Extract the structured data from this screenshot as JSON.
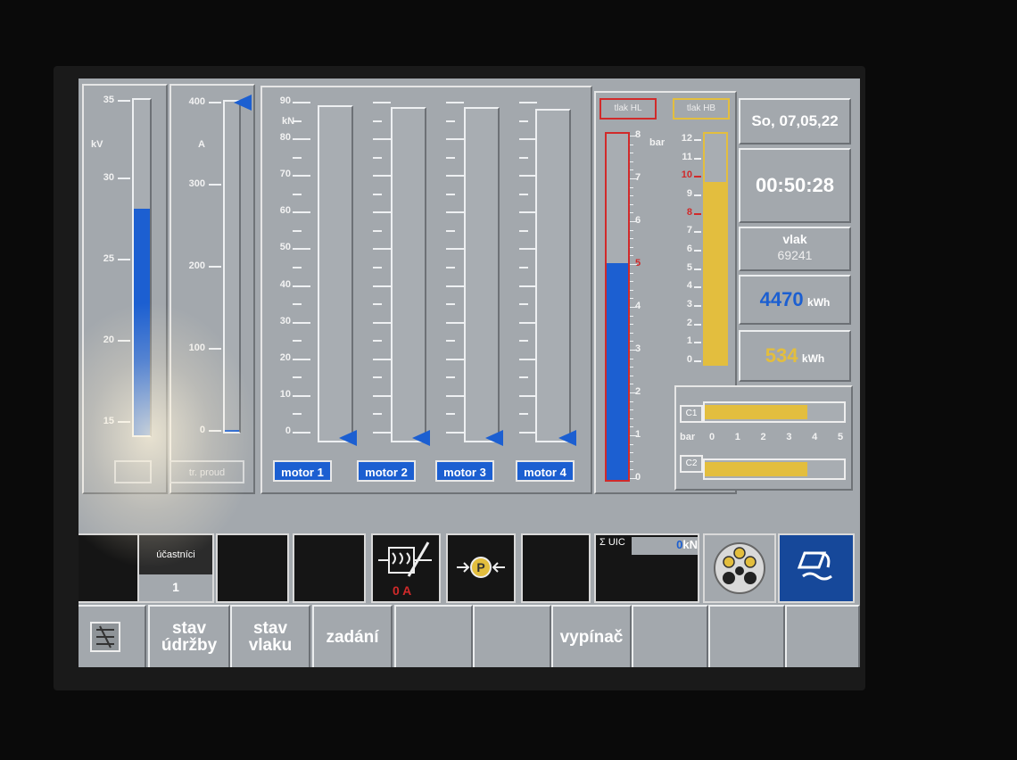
{
  "voltage": {
    "unit": "kV",
    "ticks": [
      "35",
      "30",
      "25",
      "20",
      "15"
    ],
    "level_kv": 28.0
  },
  "current": {
    "unit": "A",
    "ticks": [
      "400",
      "300",
      "200",
      "100",
      "0"
    ],
    "caption": "tr. proud",
    "level_a": 0
  },
  "force": {
    "unit": "kN",
    "ticks": [
      "90",
      "80",
      "70",
      "60",
      "50",
      "40",
      "30",
      "20",
      "10",
      "0"
    ],
    "motors": [
      {
        "label": "motor 1",
        "value_kn": 0
      },
      {
        "label": "motor 2",
        "value_kn": 0
      },
      {
        "label": "motor 3",
        "value_kn": 0
      },
      {
        "label": "motor 4",
        "value_kn": 0
      }
    ]
  },
  "pressure": {
    "hl_label": "tlak HL",
    "hb_label": "tlak HB",
    "unit": "bar",
    "hl_ticks": [
      "8",
      "7",
      "6",
      "5",
      "4",
      "3",
      "2",
      "1",
      "0"
    ],
    "hb_ticks": [
      "12",
      "11",
      "10",
      "9",
      "8",
      "7",
      "6",
      "5",
      "4",
      "3",
      "2",
      "1",
      "0"
    ],
    "hl_value_bar": 5.0,
    "hb_value_bar": 9.5
  },
  "info": {
    "date": "So, 07,05,22",
    "time": "00:50:28",
    "train_label": "vlak",
    "train_number": "69241",
    "energy_consumed": "4470",
    "energy_regen": "534",
    "energy_unit": "kWh"
  },
  "cylinders": {
    "unit": "bar",
    "scale": [
      "0",
      "1",
      "2",
      "3",
      "4",
      "5"
    ],
    "c1": {
      "label": "C1",
      "value_bar": 3.7
    },
    "c2": {
      "label": "C2",
      "value_bar": 3.7
    }
  },
  "status": {
    "participants_label": "účastníci",
    "participants_value": "1",
    "current_readout": "0 A",
    "uic_label": "Σ UIC",
    "uic_value": "0",
    "uic_unit": "kN"
  },
  "bottom": {
    "buttons": [
      "stav údržby",
      "stav vlaku",
      "zadání",
      "",
      "",
      "vypínač",
      "",
      "",
      ""
    ]
  },
  "colors": {
    "blue": "#1c5fd1",
    "yellow": "#e3be3e",
    "red": "#d12a2a",
    "bg": "#a3a8ad"
  }
}
